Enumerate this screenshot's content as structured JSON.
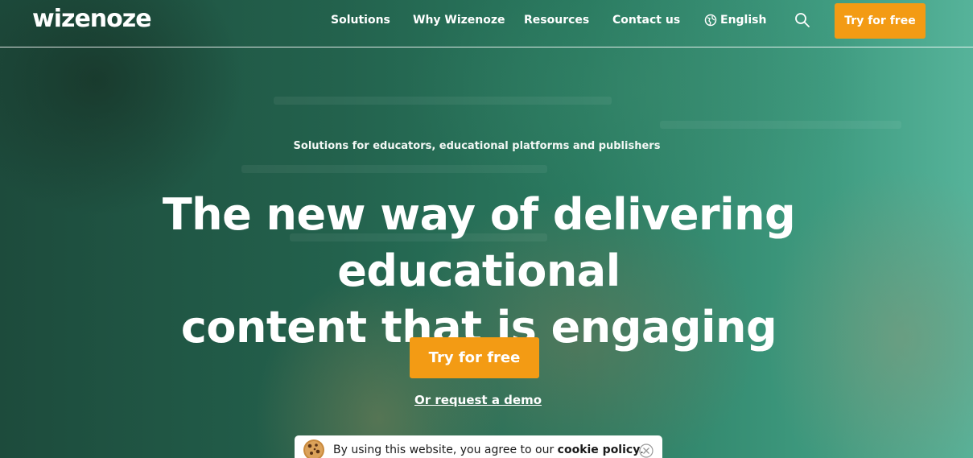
{
  "brand": {
    "logo_text": "wizenoze",
    "accent": "#f39b14",
    "overlay": "#23624d"
  },
  "nav": {
    "items": [
      {
        "label": "Solutions"
      },
      {
        "label": "Why Wizenoze"
      },
      {
        "label": "Resources"
      },
      {
        "label": "Contact us"
      }
    ],
    "language": "English",
    "language_icon": "globe-icon",
    "search_icon": "search-icon",
    "cta_label": "Try for free"
  },
  "hero": {
    "subtitle": "Solutions for educators, educational platforms and publishers",
    "headline_line1": "The new way of delivering educational",
    "headline_line2": "content that is engaging",
    "cta_label": "Try for free",
    "secondary_link": "Or request a demo"
  },
  "cookie": {
    "text_prefix": "By using this website, you agree to our ",
    "policy_link": "cookie policy",
    "text_suffix": ".",
    "icon": "cookie-icon",
    "close_icon": "close-icon"
  }
}
